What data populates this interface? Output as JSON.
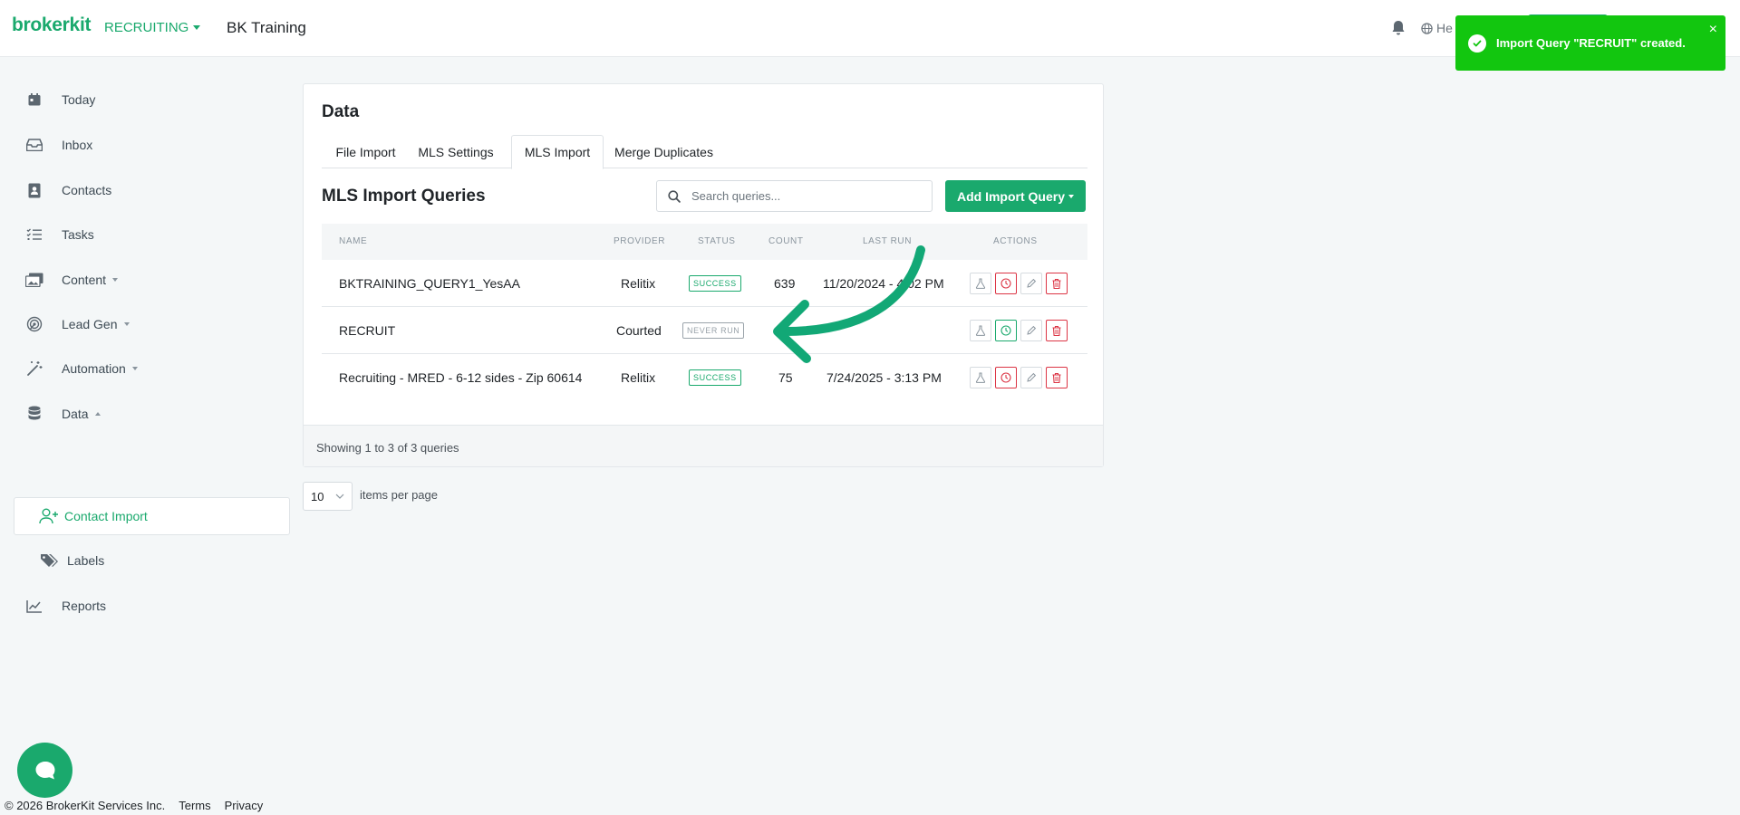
{
  "header": {
    "brand": "brokerkit",
    "module": "RECRUITING",
    "org": "BK Training",
    "help_label": "He"
  },
  "toast": {
    "message": "Import Query \"RECRUIT\" created.",
    "close": "×"
  },
  "sidebar": {
    "items": [
      {
        "label": "Today"
      },
      {
        "label": "Inbox"
      },
      {
        "label": "Contacts"
      },
      {
        "label": "Tasks"
      },
      {
        "label": "Content"
      },
      {
        "label": "Lead Gen"
      },
      {
        "label": "Automation"
      },
      {
        "label": "Data"
      },
      {
        "label": "Contact Import"
      },
      {
        "label": "Labels"
      },
      {
        "label": "Reports"
      }
    ]
  },
  "main": {
    "title": "Data",
    "tabs": [
      {
        "label": "File Import"
      },
      {
        "label": "MLS Settings"
      },
      {
        "label": "MLS Import"
      },
      {
        "label": "Merge Duplicates"
      }
    ],
    "section_title": "MLS Import Queries",
    "search_placeholder": "Search queries...",
    "add_button": "Add Import Query",
    "columns": [
      "Name",
      "Provider",
      "Status",
      "Count",
      "Last Run",
      "Actions"
    ],
    "rows": [
      {
        "name": "BKTRAINING_QUERY1_YesAA",
        "provider": "Relitix",
        "status": "SUCCESS",
        "count": "639",
        "last_run": "11/20/2024 - 4:02 PM"
      },
      {
        "name": "RECRUIT",
        "provider": "Courted",
        "status": "NEVER RUN",
        "count": "",
        "last_run": ""
      },
      {
        "name": "Recruiting - MRED - 6-12 sides - Zip 60614",
        "provider": "Relitix",
        "status": "SUCCESS",
        "count": "75",
        "last_run": "7/24/2025 - 3:13 PM"
      }
    ],
    "showing": "Showing 1 to 3 of 3 queries",
    "per_page_value": "10",
    "per_page_label": "items per page"
  },
  "footer": {
    "copyright": "© 2026 BrokerKit Services Inc.",
    "terms": "Terms",
    "privacy": "Privacy"
  },
  "colors": {
    "brand_green": "#1aa96d",
    "toast_green": "#12c60f",
    "danger_red": "#dc3545"
  }
}
